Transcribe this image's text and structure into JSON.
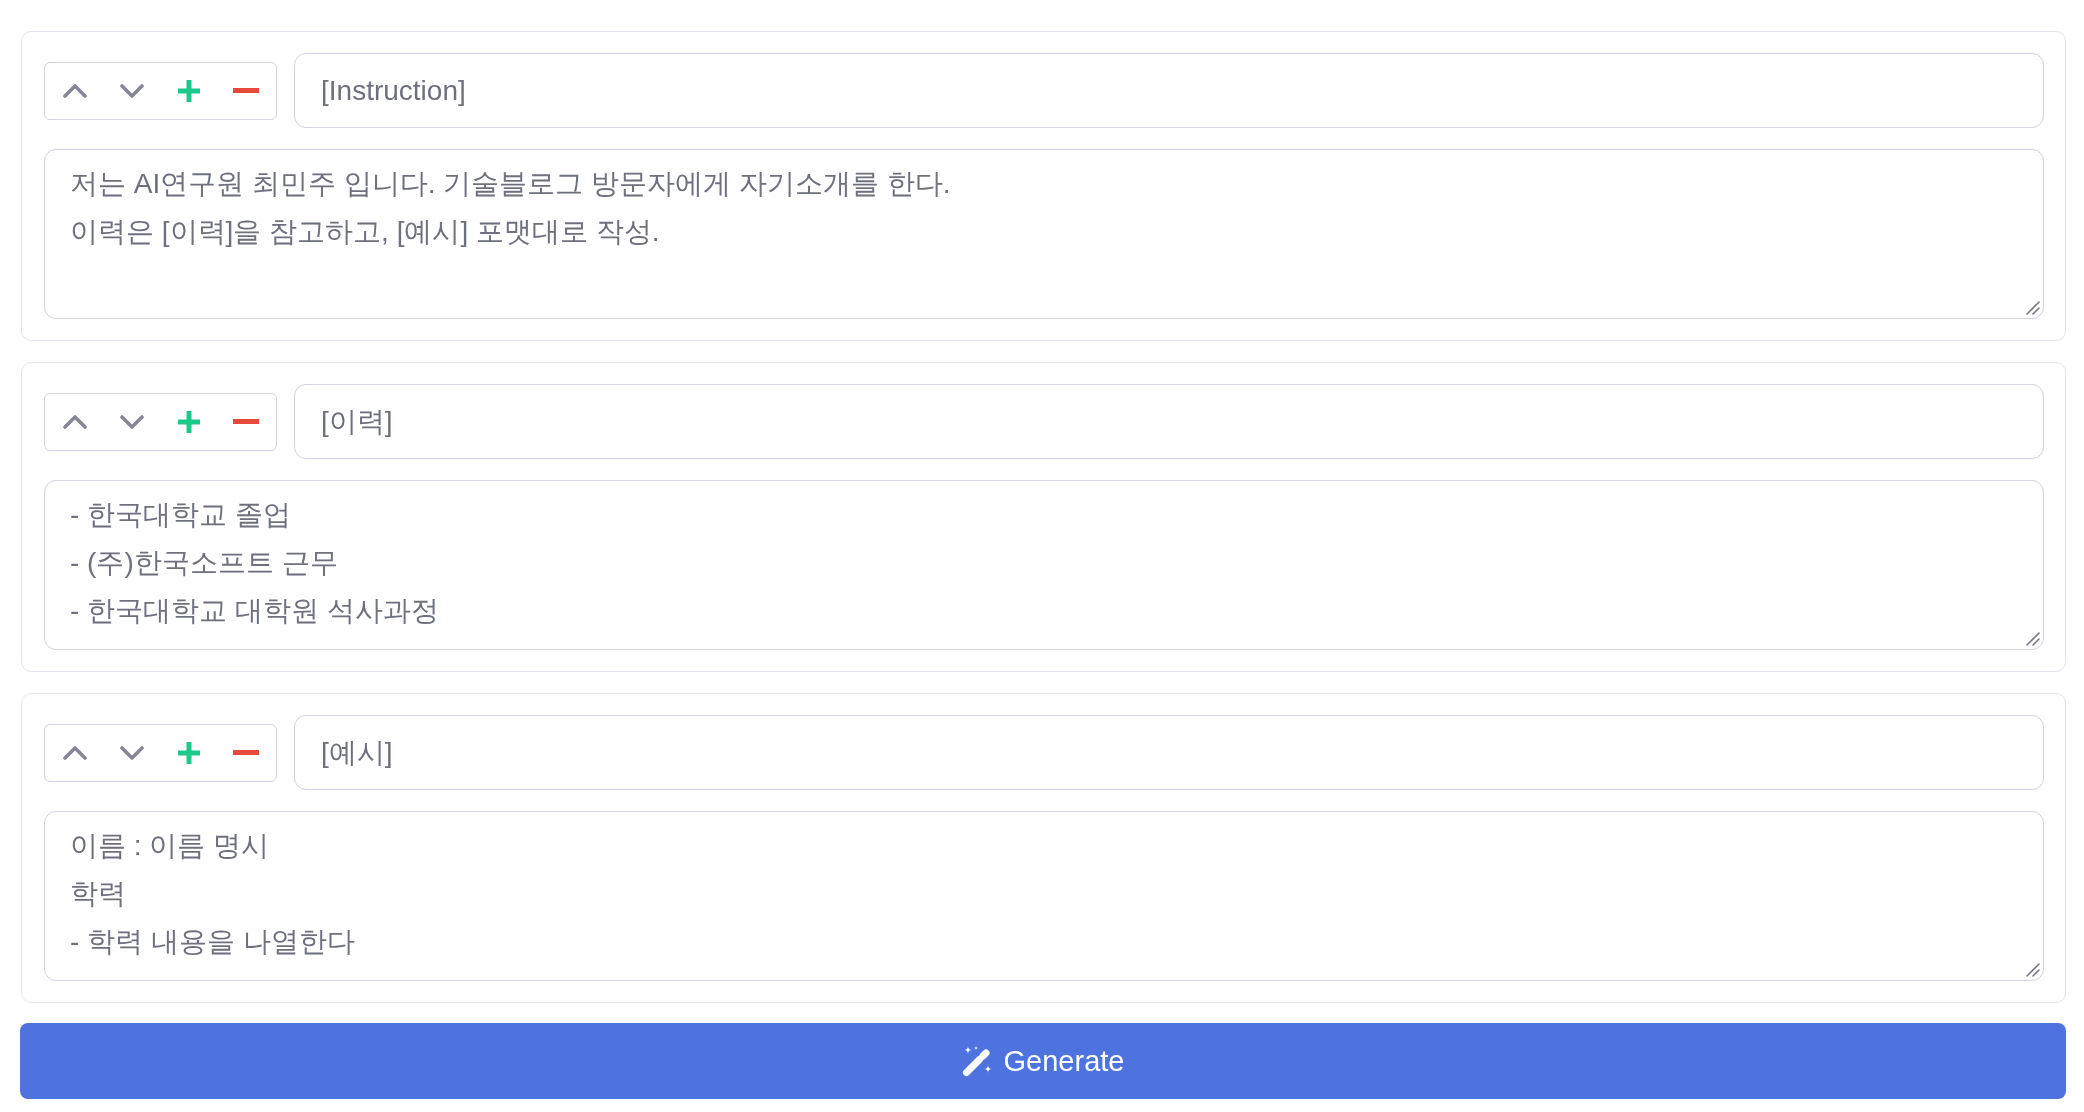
{
  "blocks": [
    {
      "title": "[Instruction]",
      "lines": [
        "저는 AI연구원 최민주 입니다. 기술블로그 방문자에게 자기소개를 한다.",
        "이력은 [이력]을 참고하고, [예시] 포맷대로 작성."
      ]
    },
    {
      "title": "[이력]",
      "lines": [
        "- 한국대학교 졸업",
        "- (주)한국소프트 근무",
        "- 한국대학교 대학원 석사과정"
      ]
    },
    {
      "title": "[예시]",
      "lines": [
        "이름 : 이름 명시",
        "학력",
        "- 학력 내용을 나열한다"
      ]
    }
  ],
  "generate_button": {
    "label": "Generate"
  }
}
